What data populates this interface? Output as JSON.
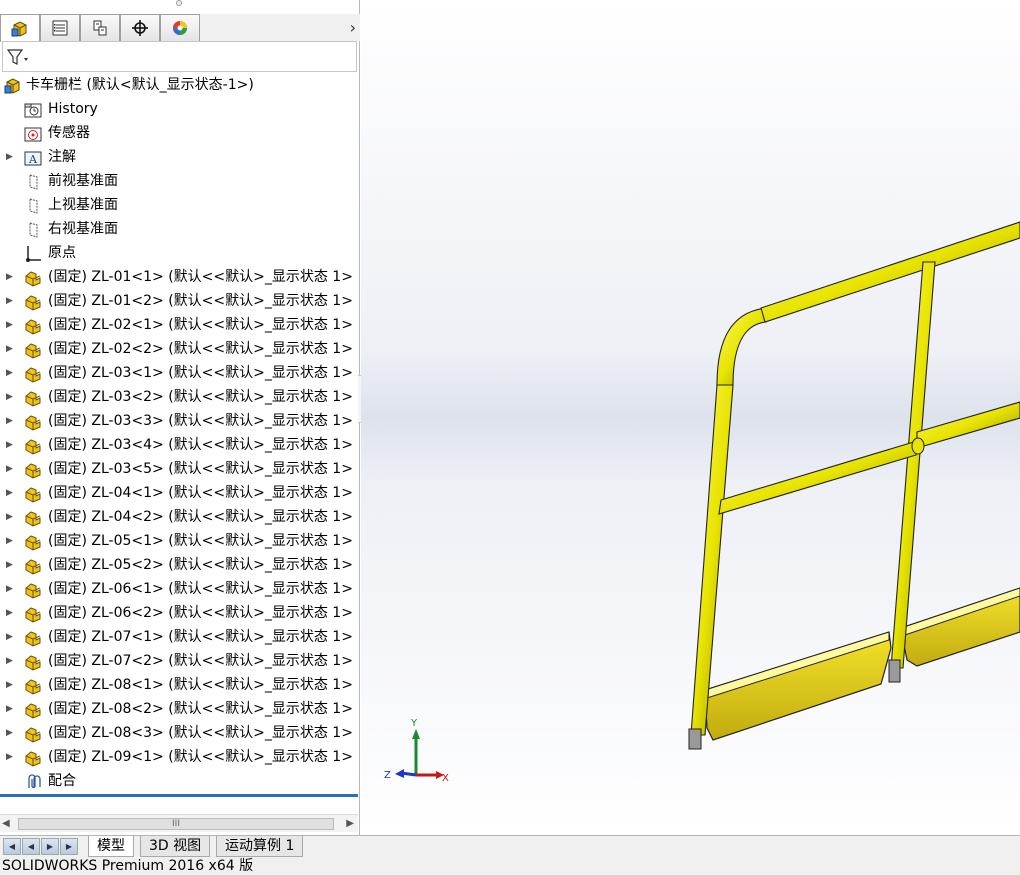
{
  "feature_manager": {
    "tabs": [
      {
        "icon": "feature-tree-icon",
        "active": true
      },
      {
        "icon": "property-manager-icon",
        "active": false
      },
      {
        "icon": "configuration-manager-icon",
        "active": false
      },
      {
        "icon": "dimxpert-icon",
        "active": false
      },
      {
        "icon": "display-manager-icon",
        "active": false
      }
    ],
    "more_glyph": "›"
  },
  "tree": {
    "root": "卡车栅栏 (默认<默认_显示状态-1>)",
    "items": [
      {
        "label": "History",
        "icon": "history-folder-icon",
        "expandable": false
      },
      {
        "label": "传感器",
        "icon": "sensor-icon",
        "expandable": false
      },
      {
        "label": "注解",
        "icon": "annotation-icon",
        "expandable": true
      },
      {
        "label": "前视基准面",
        "icon": "plane-icon",
        "expandable": false
      },
      {
        "label": "上视基准面",
        "icon": "plane-icon",
        "expandable": false
      },
      {
        "label": "右视基准面",
        "icon": "plane-icon",
        "expandable": false
      },
      {
        "label": "原点",
        "icon": "origin-icon",
        "expandable": false
      }
    ],
    "components": [
      "(固定) ZL-01<1> (默认<<默认>_显示状态 1>",
      "(固定) ZL-01<2> (默认<<默认>_显示状态 1>",
      "(固定) ZL-02<1> (默认<<默认>_显示状态 1>",
      "(固定) ZL-02<2> (默认<<默认>_显示状态 1>",
      "(固定) ZL-03<1> (默认<<默认>_显示状态 1>",
      "(固定) ZL-03<2> (默认<<默认>_显示状态 1>",
      "(固定) ZL-03<3> (默认<<默认>_显示状态 1>",
      "(固定) ZL-03<4> (默认<<默认>_显示状态 1>",
      "(固定) ZL-03<5> (默认<<默认>_显示状态 1>",
      "(固定) ZL-04<1> (默认<<默认>_显示状态 1>",
      "(固定) ZL-04<2> (默认<<默认>_显示状态 1>",
      "(固定) ZL-05<1> (默认<<默认>_显示状态 1>",
      "(固定) ZL-05<2> (默认<<默认>_显示状态 1>",
      "(固定) ZL-06<1> (默认<<默认>_显示状态 1>",
      "(固定) ZL-06<2> (默认<<默认>_显示状态 1>",
      "(固定) ZL-07<1> (默认<<默认>_显示状态 1>",
      "(固定) ZL-07<2> (默认<<默认>_显示状态 1>",
      "(固定) ZL-08<1> (默认<<默认>_显示状态 1>",
      "(固定) ZL-08<2> (默认<<默认>_显示状态 1>",
      "(固定) ZL-08<3> (默认<<默认>_显示状态 1>",
      "(固定) ZL-09<1> (默认<<默认>_显示状态 1>"
    ],
    "mates": "配合"
  },
  "scrollbar": {
    "thumb_glyph": "III",
    "left_glyph": "◀",
    "right_glyph": "▶"
  },
  "triad": {
    "x": "X",
    "y": "Y",
    "z": "Z"
  },
  "bottom_tabs": [
    {
      "label": "模型",
      "active": true
    },
    {
      "label": "3D 视图",
      "active": false
    },
    {
      "label": "运动算例 1",
      "active": false
    }
  ],
  "status_bar": {
    "text": "SOLIDWORKS Premium 2016 x64 版"
  },
  "colors": {
    "part_yellow": "#e8e400",
    "accent_blue": "#2c6fb6",
    "component_icon": "#f2c21b"
  }
}
